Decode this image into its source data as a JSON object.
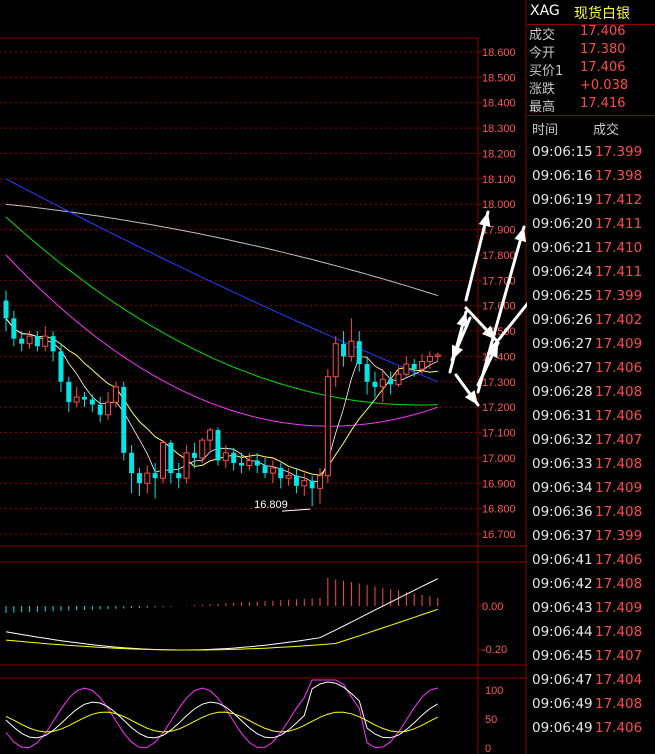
{
  "header": {
    "symbol": "XAG",
    "name": "现货白银"
  },
  "quote": [
    {
      "label": "成交",
      "value": "17.406"
    },
    {
      "label": "今开",
      "value": "17.380"
    },
    {
      "label": "买价1",
      "value": "17.406"
    },
    {
      "label": "涨跌",
      "value": "+0.038"
    },
    {
      "label": "最高",
      "value": "17.416"
    }
  ],
  "ticks_header": {
    "time": "时间",
    "price": "成交"
  },
  "ticks": [
    {
      "time": "09:06:15",
      "price": "17.399"
    },
    {
      "time": "09:06:16",
      "price": "17.398"
    },
    {
      "time": "09:06:19",
      "price": "17.412"
    },
    {
      "time": "09:06:20",
      "price": "17.411"
    },
    {
      "time": "09:06:21",
      "price": "17.410"
    },
    {
      "time": "09:06:24",
      "price": "17.411"
    },
    {
      "time": "09:06:25",
      "price": "17.399"
    },
    {
      "time": "09:06:26",
      "price": "17.402"
    },
    {
      "time": "09:06:27",
      "price": "17.409"
    },
    {
      "time": "09:06:27",
      "price": "17.406"
    },
    {
      "time": "09:06:28",
      "price": "17.408"
    },
    {
      "time": "09:06:31",
      "price": "17.406"
    },
    {
      "time": "09:06:32",
      "price": "17.407"
    },
    {
      "time": "09:06:33",
      "price": "17.408"
    },
    {
      "time": "09:06:34",
      "price": "17.409"
    },
    {
      "time": "09:06:36",
      "price": "17.408"
    },
    {
      "time": "09:06:37",
      "price": "17.399"
    },
    {
      "time": "09:06:41",
      "price": "17.406"
    },
    {
      "time": "09:06:42",
      "price": "17.408"
    },
    {
      "time": "09:06:43",
      "price": "17.409"
    },
    {
      "time": "09:06:44",
      "price": "17.408"
    },
    {
      "time": "09:06:45",
      "price": "17.407"
    },
    {
      "time": "09:06:47",
      "price": "17.404"
    },
    {
      "time": "09:06:49",
      "price": "17.408"
    },
    {
      "time": "09:06:49",
      "price": "17.406"
    }
  ],
  "colors": {
    "up": "#ff4a4a",
    "down": "#00e5e5",
    "grid": "#8a0000",
    "axis_text": "#ff5555",
    "ma5": "#ffffff",
    "ma10": "#ffff60",
    "ma20": "#ff30ff",
    "ma30": "#00e000",
    "ma60": "#2040ff",
    "ma120": "#bfbfbf",
    "macd_dif": "#ffffff",
    "macd_dea": "#ffff00",
    "kdj_k": "#ffffff",
    "kdj_d": "#ffff00",
    "kdj_j": "#ff30ff",
    "annotation": "#ffffff"
  },
  "chart_data": [
    {
      "type": "candlestick",
      "ylim": [
        16.7,
        18.6
      ],
      "yticks": [
        "18.600",
        "18.500",
        "18.400",
        "18.300",
        "18.200",
        "18.100",
        "18.000",
        "17.900",
        "17.800",
        "17.700",
        "17.600",
        "17.500",
        "17.400",
        "17.300",
        "17.200",
        "17.100",
        "17.000",
        "16.900",
        "16.800",
        "16.700"
      ],
      "low_label": "16.809",
      "candles": [
        [
          17.62,
          17.55,
          17.66,
          17.5
        ],
        [
          17.55,
          17.47,
          17.58,
          17.44
        ],
        [
          17.47,
          17.45,
          17.5,
          17.42
        ],
        [
          17.45,
          17.48,
          17.5,
          17.43
        ],
        [
          17.48,
          17.44,
          17.5,
          17.42
        ],
        [
          17.44,
          17.48,
          17.52,
          17.42
        ],
        [
          17.48,
          17.42,
          17.5,
          17.38
        ],
        [
          17.42,
          17.3,
          17.45,
          17.26
        ],
        [
          17.3,
          17.22,
          17.32,
          17.18
        ],
        [
          17.22,
          17.24,
          17.28,
          17.2
        ],
        [
          17.24,
          17.23,
          17.26,
          17.2
        ],
        [
          17.23,
          17.21,
          17.25,
          17.18
        ],
        [
          17.21,
          17.17,
          17.24,
          17.14
        ],
        [
          17.17,
          17.22,
          17.26,
          17.15
        ],
        [
          17.22,
          17.28,
          17.3,
          17.2
        ],
        [
          17.28,
          17.02,
          17.3,
          16.99
        ],
        [
          17.02,
          16.94,
          17.05,
          16.86
        ],
        [
          16.94,
          16.9,
          16.96,
          16.85
        ],
        [
          16.9,
          16.94,
          16.97,
          16.86
        ],
        [
          16.94,
          16.92,
          16.98,
          16.84
        ],
        [
          16.92,
          17.06,
          17.07,
          16.9
        ],
        [
          17.06,
          16.94,
          17.07,
          16.9
        ],
        [
          16.94,
          16.92,
          16.98,
          16.88
        ],
        [
          16.92,
          17.02,
          17.05,
          16.9
        ],
        [
          17.02,
          17.0,
          17.06,
          16.96
        ],
        [
          17.0,
          17.07,
          17.08,
          16.98
        ],
        [
          17.07,
          17.11,
          17.12,
          17.02
        ],
        [
          17.11,
          16.99,
          17.12,
          16.97
        ],
        [
          16.99,
          17.02,
          17.05,
          16.96
        ],
        [
          17.02,
          16.98,
          17.04,
          16.95
        ],
        [
          16.98,
          16.97,
          17.02,
          16.94
        ],
        [
          16.97,
          16.99,
          17.02,
          16.95
        ],
        [
          16.99,
          16.97,
          17.02,
          16.94
        ],
        [
          16.97,
          16.94,
          17.0,
          16.92
        ],
        [
          16.94,
          16.96,
          16.99,
          16.9
        ],
        [
          16.96,
          16.92,
          16.98,
          16.88
        ],
        [
          16.92,
          16.93,
          16.96,
          16.89
        ],
        [
          16.93,
          16.89,
          16.96,
          16.86
        ],
        [
          16.89,
          16.91,
          16.94,
          16.85
        ],
        [
          16.91,
          16.88,
          16.93,
          16.81
        ],
        [
          16.88,
          16.93,
          16.96,
          16.82
        ],
        [
          16.93,
          17.32,
          17.35,
          16.9
        ],
        [
          17.32,
          17.45,
          17.48,
          17.28
        ],
        [
          17.45,
          17.4,
          17.5,
          17.36
        ],
        [
          17.4,
          17.46,
          17.55,
          17.38
        ],
        [
          17.46,
          17.37,
          17.5,
          17.34
        ],
        [
          17.37,
          17.3,
          17.4,
          17.25
        ],
        [
          17.3,
          17.28,
          17.34,
          17.24
        ],
        [
          17.28,
          17.31,
          17.35,
          17.22
        ],
        [
          17.31,
          17.29,
          17.34,
          17.25
        ],
        [
          17.29,
          17.33,
          17.36,
          17.28
        ],
        [
          17.33,
          17.37,
          17.4,
          17.32
        ],
        [
          17.37,
          17.35,
          17.39,
          17.32
        ],
        [
          17.35,
          17.38,
          17.41,
          17.33
        ],
        [
          17.38,
          17.4,
          17.42,
          17.35
        ],
        [
          17.4,
          17.406,
          17.416,
          17.38
        ]
      ]
    },
    {
      "type": "macd",
      "yticks": [
        "0.00",
        "-0.20"
      ]
    },
    {
      "type": "kdj",
      "yticks": [
        "100",
        "50",
        "0"
      ]
    }
  ]
}
